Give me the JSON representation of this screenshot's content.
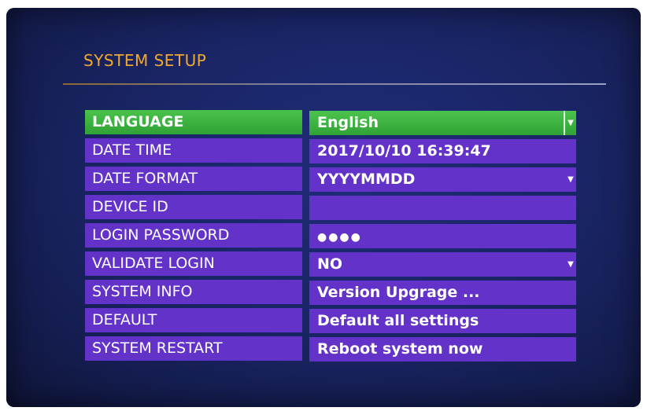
{
  "title": "SYSTEM SETUP",
  "rows": [
    {
      "label": "LANGUAGE",
      "value": "English",
      "dropdown": true
    },
    {
      "label": "DATE TIME",
      "value": "2017/10/10 16:39:47",
      "dropdown": false
    },
    {
      "label": "DATE FORMAT",
      "value": "YYYYMMDD",
      "dropdown": true
    },
    {
      "label": "DEVICE ID",
      "value": "",
      "dropdown": false
    },
    {
      "label": "LOGIN PASSWORD",
      "value": "●●●●",
      "dropdown": false
    },
    {
      "label": "VALIDATE LOGIN",
      "value": "NO",
      "dropdown": true
    },
    {
      "label": "SYSTEM INFO",
      "value": "Version  Upgrage ...",
      "dropdown": false
    },
    {
      "label": "DEFAULT",
      "value": "Default all settings",
      "dropdown": false
    },
    {
      "label": "SYSTEM RESTART",
      "value": "Reboot system now",
      "dropdown": false
    }
  ],
  "dropdown_icon": "chevron-down-icon",
  "colors": {
    "background": "#1a2566",
    "row": "#6333c9",
    "selected": "#3fb541",
    "title": "#f0a830"
  }
}
